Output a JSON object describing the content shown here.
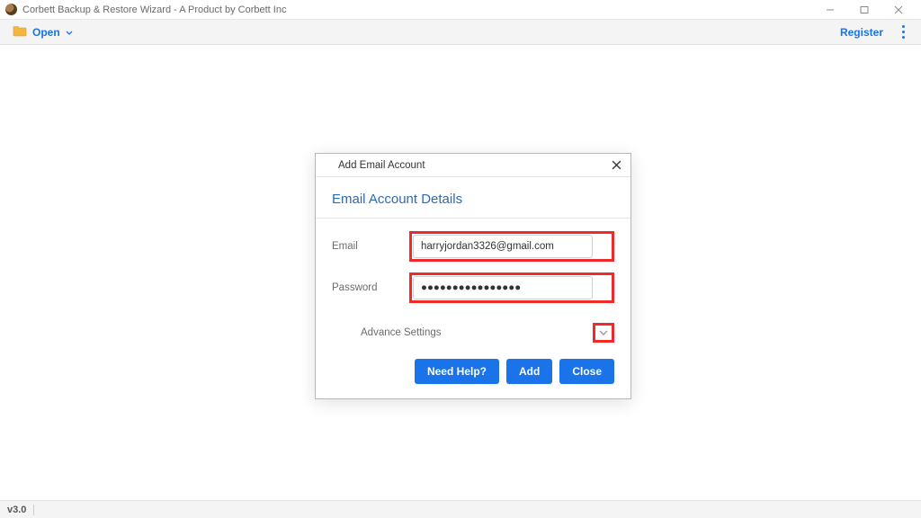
{
  "window": {
    "title": "Corbett Backup & Restore Wizard - A Product by Corbett Inc"
  },
  "toolbar": {
    "open_label": "Open",
    "register_label": "Register"
  },
  "dialog": {
    "title": "Add Email Account",
    "section_heading": "Email Account Details",
    "email": {
      "label": "Email",
      "value": "harryjordan3326@gmail.com"
    },
    "password": {
      "label": "Password",
      "value": "●●●●●●●●●●●●●●●●"
    },
    "advance_label": "Advance Settings",
    "buttons": {
      "help": "Need Help?",
      "add": "Add",
      "close": "Close"
    }
  },
  "status": {
    "version": "v3.0"
  }
}
